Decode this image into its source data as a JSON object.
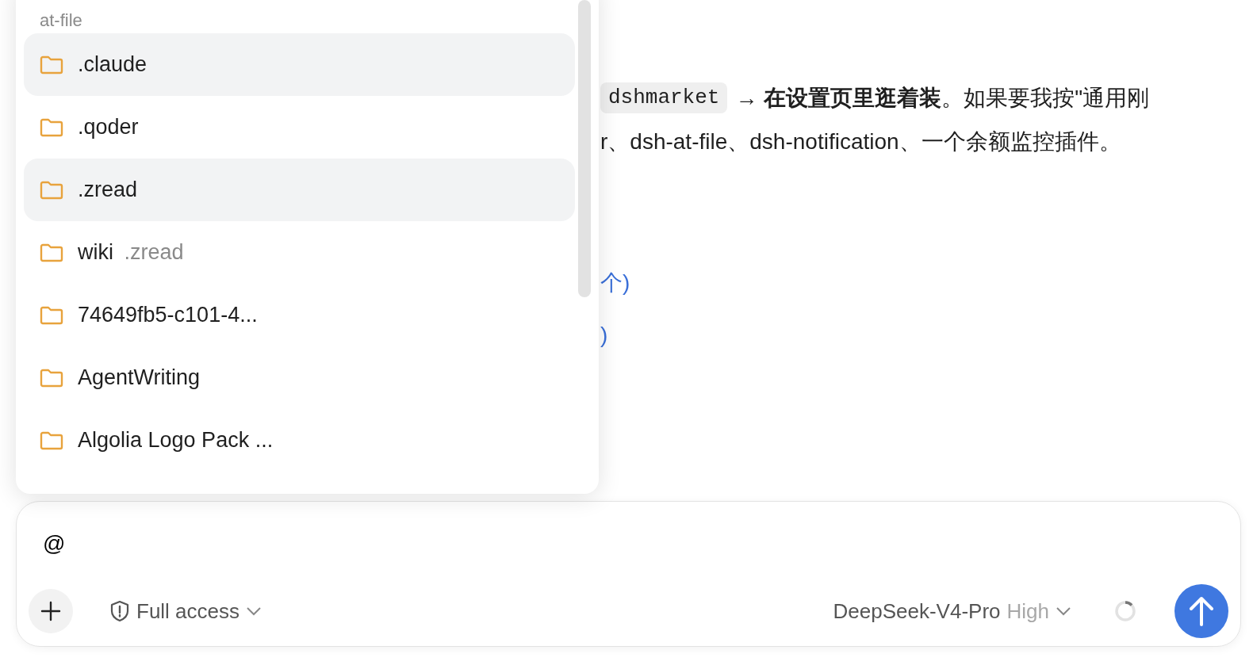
{
  "message": {
    "code": "dshmarket",
    "line_1": "**→ 在设置页里逛着装**。如果要我按\"通用刚",
    "line_2": "r、dsh-at-file、dsh-notification、一个余额监控插件。",
    "links": [
      "个)",
      ")"
    ]
  },
  "file_menu": {
    "title": "at-file",
    "items": [
      {
        "name": ".claude",
        "highlighted": true
      },
      {
        "name": ".qoder",
        "highlighted": false
      },
      {
        "name": ".zread",
        "highlighted": true
      },
      {
        "name": "wiki",
        "path": ".zread",
        "highlighted": false
      },
      {
        "name": "74649fb5-c101-4...",
        "highlighted": false
      },
      {
        "name": "AgentWriting",
        "highlighted": false
      },
      {
        "name": "Algolia Logo Pack ...",
        "highlighted": false
      }
    ]
  },
  "composer": {
    "value": "@",
    "access": "Full access",
    "model": "DeepSeek-V4-Pro",
    "effort": "High"
  }
}
